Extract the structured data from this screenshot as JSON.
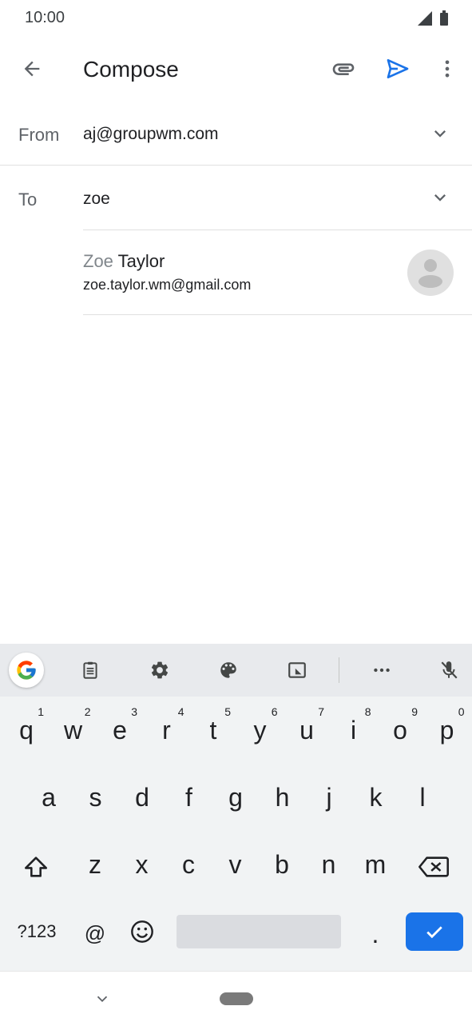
{
  "status": {
    "time": "10:00"
  },
  "appbar": {
    "title": "Compose"
  },
  "from": {
    "label": "From",
    "value": "aj@groupwm.com"
  },
  "to": {
    "label": "To",
    "value": "zoe"
  },
  "suggestion": {
    "name_typed": "Zoe",
    "name_rest": " Taylor",
    "email": "zoe.taylor.wm@gmail.com"
  },
  "keyboard": {
    "row1": [
      {
        "k": "q",
        "h": "1"
      },
      {
        "k": "w",
        "h": "2"
      },
      {
        "k": "e",
        "h": "3"
      },
      {
        "k": "r",
        "h": "4"
      },
      {
        "k": "t",
        "h": "5"
      },
      {
        "k": "y",
        "h": "6"
      },
      {
        "k": "u",
        "h": "7"
      },
      {
        "k": "i",
        "h": "8"
      },
      {
        "k": "o",
        "h": "9"
      },
      {
        "k": "p",
        "h": "0"
      }
    ],
    "row2": [
      "a",
      "s",
      "d",
      "f",
      "g",
      "h",
      "j",
      "k",
      "l"
    ],
    "row3": [
      "z",
      "x",
      "c",
      "v",
      "b",
      "n",
      "m"
    ],
    "symbols_label": "?123",
    "at_label": "@",
    "period_label": "."
  },
  "colors": {
    "accent": "#1a73e8",
    "send": "#1a73e8"
  },
  "icons": {
    "toolbar": [
      "google-icon",
      "clipboard-icon",
      "settings-icon",
      "palette-icon",
      "floating-keyboard-icon",
      "more-horizontal-icon",
      "mic-off-icon"
    ]
  }
}
